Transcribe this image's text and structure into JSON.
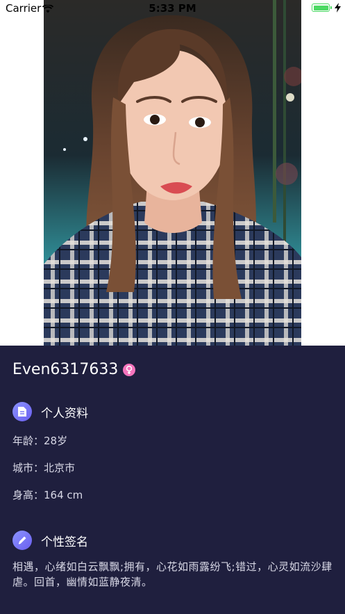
{
  "status_bar": {
    "carrier": "Carrier",
    "time": "5:33 PM",
    "battery_level": 1.0,
    "battery_color": "#4cd964"
  },
  "profile": {
    "username": "Even6317633",
    "gender_icon": "female-icon",
    "gender_color": "#f474bd"
  },
  "sections": {
    "personal": {
      "title": "个人资料",
      "icon": "document-icon",
      "rows": [
        {
          "label": "年龄：",
          "value": "28岁"
        },
        {
          "label": "城市：",
          "value": "北京市"
        },
        {
          "label": "身高：",
          "value": "164 cm"
        }
      ]
    },
    "signature": {
      "title": "个性签名",
      "icon": "pencil-icon",
      "text": "相遇，心绪如白云飘飘;拥有，心花如雨露纷飞;错过，心灵如流沙肆虐。回首，幽情如蓝静夜清。"
    }
  },
  "colors": {
    "panel_bg": "#1f1f3e",
    "accent": "#7b7cf6"
  }
}
